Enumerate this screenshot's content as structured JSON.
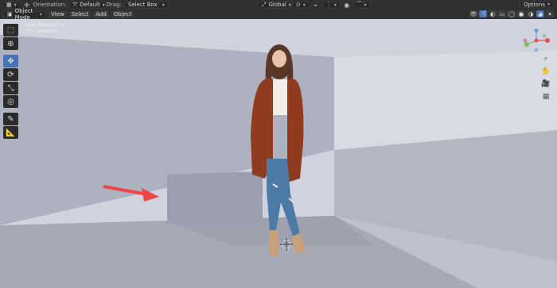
{
  "topbar": {
    "orientation_label": "Orientation:",
    "orientation_value": "Default",
    "drag_label": "Drag:",
    "drag_value": "Select Box",
    "transform_value": "Global",
    "options_label": "Options"
  },
  "subbar": {
    "mode": "Object Mode",
    "menu": [
      "View",
      "Select",
      "Add",
      "Object"
    ]
  },
  "viewport": {
    "view_name": "User Perspective",
    "collection": "(1) Collection"
  },
  "colors": {
    "accent": "#4772b3",
    "viewport_bg": "#c8cad6",
    "arrow": "#f04545"
  },
  "icons": {
    "toolbar": [
      "select-box-icon",
      "cursor-icon",
      "move-icon",
      "rotate-icon",
      "scale-icon",
      "transform-icon",
      "annotate-icon",
      "measure-icon"
    ],
    "nav": [
      "zoom-icon",
      "hand-icon",
      "camera-icon",
      "grid-icon"
    ]
  }
}
